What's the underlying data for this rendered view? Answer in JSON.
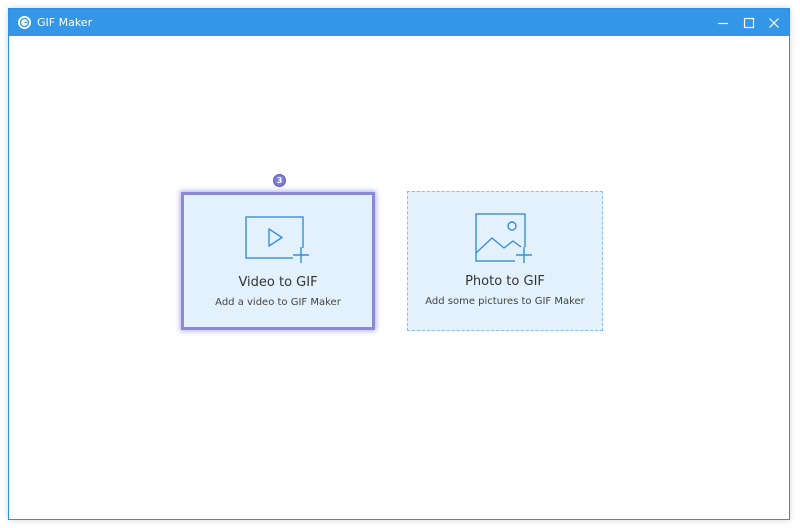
{
  "window": {
    "title": "GIF Maker",
    "icon": "gif-maker-logo-icon",
    "controls": [
      "minimize-icon",
      "maximize-icon",
      "close-icon"
    ]
  },
  "cards": {
    "video": {
      "icon": "video-add-icon",
      "title": "Video to GIF",
      "subtitle": "Add a video to GIF Maker"
    },
    "photo": {
      "icon": "photo-add-icon",
      "title": "Photo to GIF",
      "subtitle": "Add some pictures to GIF Maker"
    }
  },
  "step_badge": {
    "label": "3"
  },
  "colors": {
    "titlebar": "#3396e6",
    "card_background": "#e3f1fd",
    "icon_stroke": "#3a8fd9",
    "highlight": "#8a8ad8"
  }
}
